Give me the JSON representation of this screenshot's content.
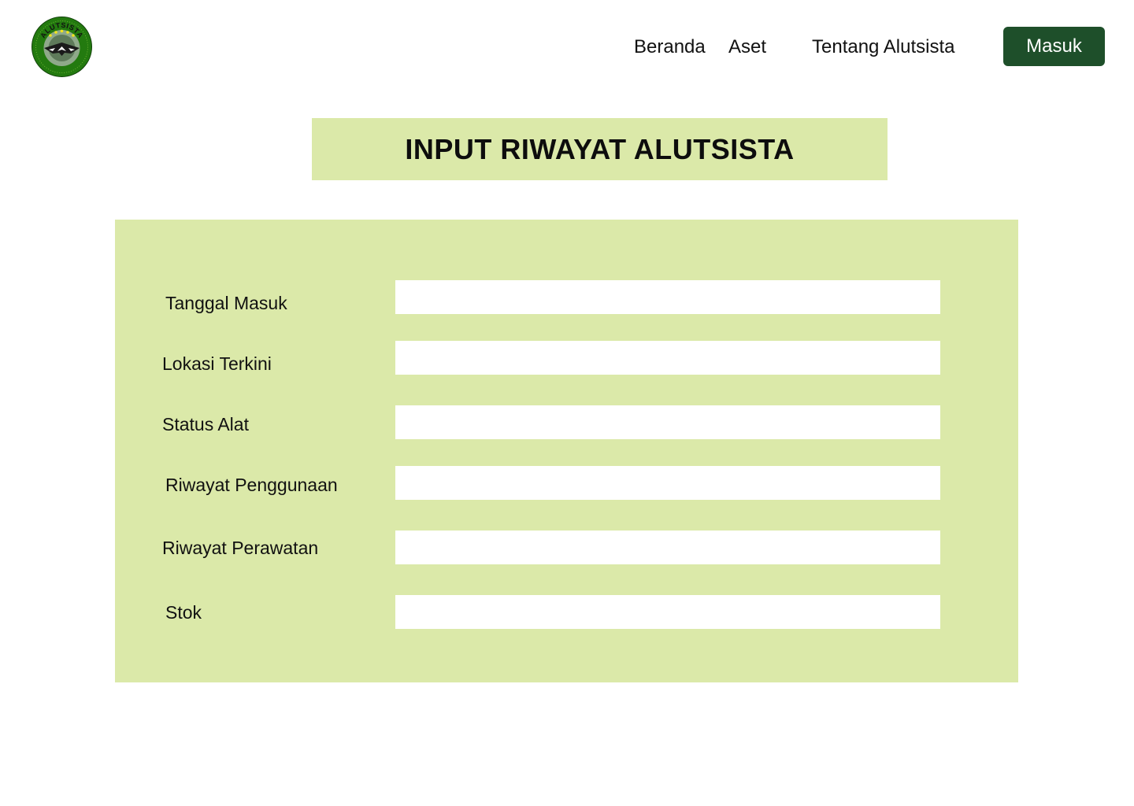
{
  "header": {
    "logo": {
      "icon": "alutsista-emblem-icon",
      "emblem_text": "ALUTSISTA"
    },
    "nav": {
      "beranda": "Beranda",
      "aset": "Aset",
      "tentang": "Tentang Alutsista"
    },
    "login_label": "Masuk"
  },
  "page": {
    "title": "INPUT RIWAYAT ALUTSISTA"
  },
  "form": {
    "fields": [
      {
        "label": "Tanggal Masuk",
        "value": "",
        "placeholder": ""
      },
      {
        "label": "Lokasi Terkini",
        "value": "",
        "placeholder": ""
      },
      {
        "label": "Status Alat",
        "value": "",
        "placeholder": ""
      },
      {
        "label": "Riwayat Penggunaan",
        "value": "",
        "placeholder": ""
      },
      {
        "label": "Riwayat Perawatan",
        "value": "",
        "placeholder": ""
      },
      {
        "label": "Stok",
        "value": "",
        "placeholder": ""
      }
    ]
  },
  "colors": {
    "panel_green": "#dbe9a9",
    "button_green": "#1e4f2a",
    "logo_green": "#237a0f"
  }
}
